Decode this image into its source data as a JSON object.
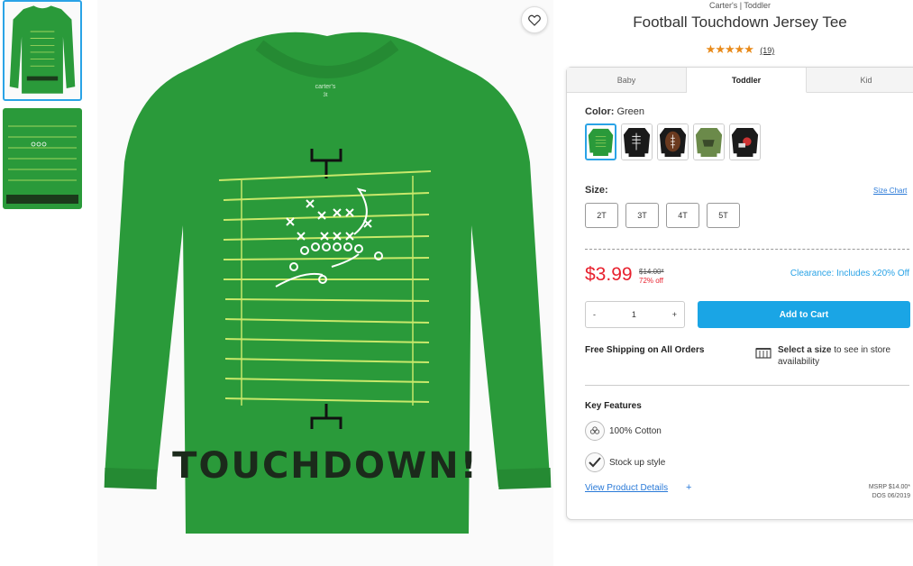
{
  "breadcrumb": "Carter's | Toddler",
  "product": {
    "title": "Football Touchdown Jersey Tee",
    "stars": "★★★★★",
    "rating": 5,
    "review_count": "(19)"
  },
  "shirt_text": {
    "brand_tag": "carter's",
    "size_tag": "3t",
    "graphic": "TOUCHDOWN!"
  },
  "tabs": [
    {
      "label": "Baby"
    },
    {
      "label": "Toddler"
    },
    {
      "label": "Kid"
    }
  ],
  "color": {
    "label": "Color:",
    "value": "Green"
  },
  "size": {
    "label": "Size:",
    "chart_link": "Size Chart",
    "options": [
      "2T",
      "3T",
      "4T",
      "5T"
    ]
  },
  "pricing": {
    "price": "$3.99",
    "original": "$14.00*",
    "percent_off": "72% off",
    "clearance": "Clearance: Includes x20% Off"
  },
  "cart": {
    "minus": "-",
    "quantity": "1",
    "plus": "+",
    "add_label": "Add to Cart"
  },
  "shipping": {
    "free": "Free Shipping on All Orders",
    "store_bold": "Select a size",
    "store_rest": " to see in store availability"
  },
  "features": {
    "heading": "Key Features",
    "items": [
      "100% Cotton",
      "Stock up style"
    ]
  },
  "details": {
    "link": "View Product Details",
    "plus": "+",
    "msrp": "MSRP $14.00*",
    "dos": "DOS 06/2019"
  },
  "colors": {
    "accent": "#2aa3e6",
    "price_red": "#e8212e",
    "shirt_green": "#2a9a3a",
    "star": "#e88a1a"
  }
}
